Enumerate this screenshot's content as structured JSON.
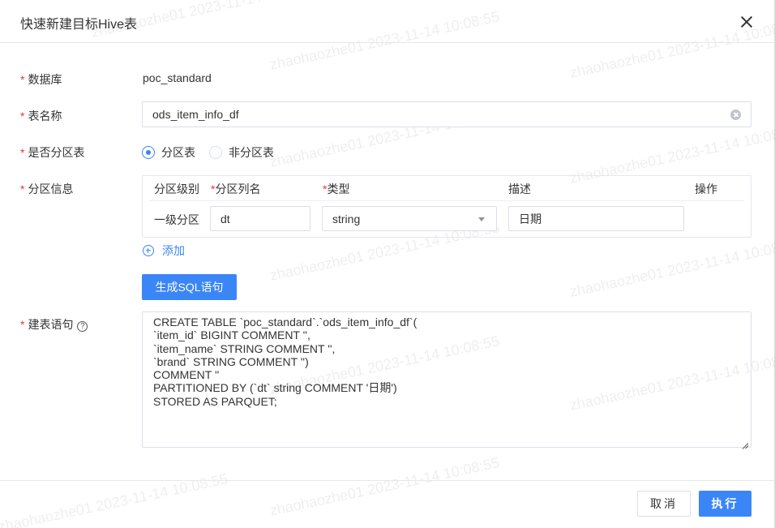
{
  "dialog": {
    "title": "快速新建目标Hive表"
  },
  "form": {
    "database": {
      "label": "数据库",
      "value": "poc_standard"
    },
    "table_name": {
      "label": "表名称",
      "value": "ods_item_info_df"
    },
    "is_partitioned": {
      "label": "是否分区表",
      "options": [
        {
          "label": "分区表",
          "checked": true
        },
        {
          "label": "非分区表",
          "checked": false
        }
      ]
    },
    "partition_info": {
      "label": "分区信息",
      "columns": {
        "level": "分区级别",
        "name": "分区列名",
        "type": "类型",
        "desc": "描述",
        "ops": "操作"
      },
      "rows": [
        {
          "level": "一级分区",
          "name": "dt",
          "type": "string",
          "desc": "日期"
        }
      ],
      "add_label": "添加"
    },
    "generate_button": "生成SQL语句",
    "ddl": {
      "label": "建表语句",
      "help": "?",
      "value": "CREATE TABLE `poc_standard`.`ods_item_info_df`(\n`item_id` BIGINT COMMENT '',\n`item_name` STRING COMMENT '',\n`brand` STRING COMMENT '')\nCOMMENT ''\nPARTITIONED BY (`dt` string COMMENT '日期')\nSTORED AS PARQUET;"
    }
  },
  "required_mark": "*",
  "footer": {
    "cancel": "取消",
    "execute": "执行"
  },
  "watermark": {
    "text": "zhaohaozhe01 2023-11-14 10:08:55"
  },
  "colors": {
    "primary": "#3b86f7",
    "required": "#e53935"
  }
}
